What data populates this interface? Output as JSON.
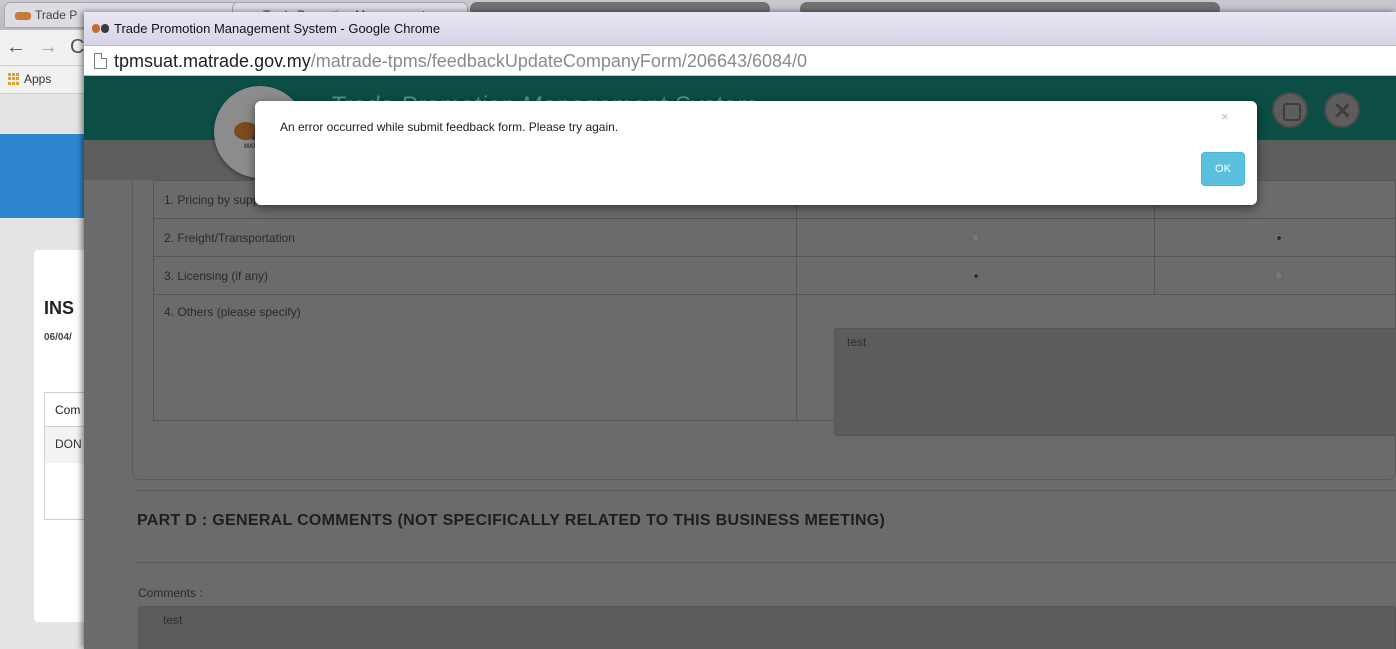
{
  "background_window": {
    "tabs": [
      {
        "label": "Trade P"
      },
      {
        "label": "Trade Promotion Management"
      }
    ],
    "nav": {
      "back": "←",
      "forward": "→",
      "reload": "C"
    },
    "bookmarks": {
      "apps_label": "Apps"
    },
    "card": {
      "title": "INS",
      "date": "06/04/",
      "table_header": "Com",
      "table_cell": "DON"
    }
  },
  "popup_window": {
    "title": "Trade Promotion Management System - Google Chrome",
    "url": {
      "host": "tpmsuat.matrade.gov.my",
      "path": "/matrade-tpms/feedbackUpdateCompanyForm/206643/6084/0"
    }
  },
  "app": {
    "title": "Trade Promotion Management System",
    "logo_text": "MATRADE",
    "constraints": [
      {
        "label": "1. Pricing by suppliers",
        "col1_selected": null,
        "col2_selected": null
      },
      {
        "label": "2. Freight/Transportation",
        "col1_selected": false,
        "col2_selected": true
      },
      {
        "label": "3. Licensing (if any)",
        "col1_selected": true,
        "col2_selected": false
      },
      {
        "label": "4. Others (please specify)",
        "value": "test"
      }
    ],
    "part_d": {
      "heading": "PART D : GENERAL COMMENTS (NOT SPECIFICALLY RELATED TO THIS BUSINESS MEETING)",
      "comments_label": "Comments :",
      "comments_value": "test"
    }
  },
  "modal": {
    "message": "An error occurred while submit feedback form. Please try again.",
    "close_glyph": "×",
    "ok_label": "OK",
    "ok_color": "#5bc0de"
  },
  "colors": {
    "header_teal": "#0c4d46",
    "bg_banner_blue": "#2f86d0"
  }
}
